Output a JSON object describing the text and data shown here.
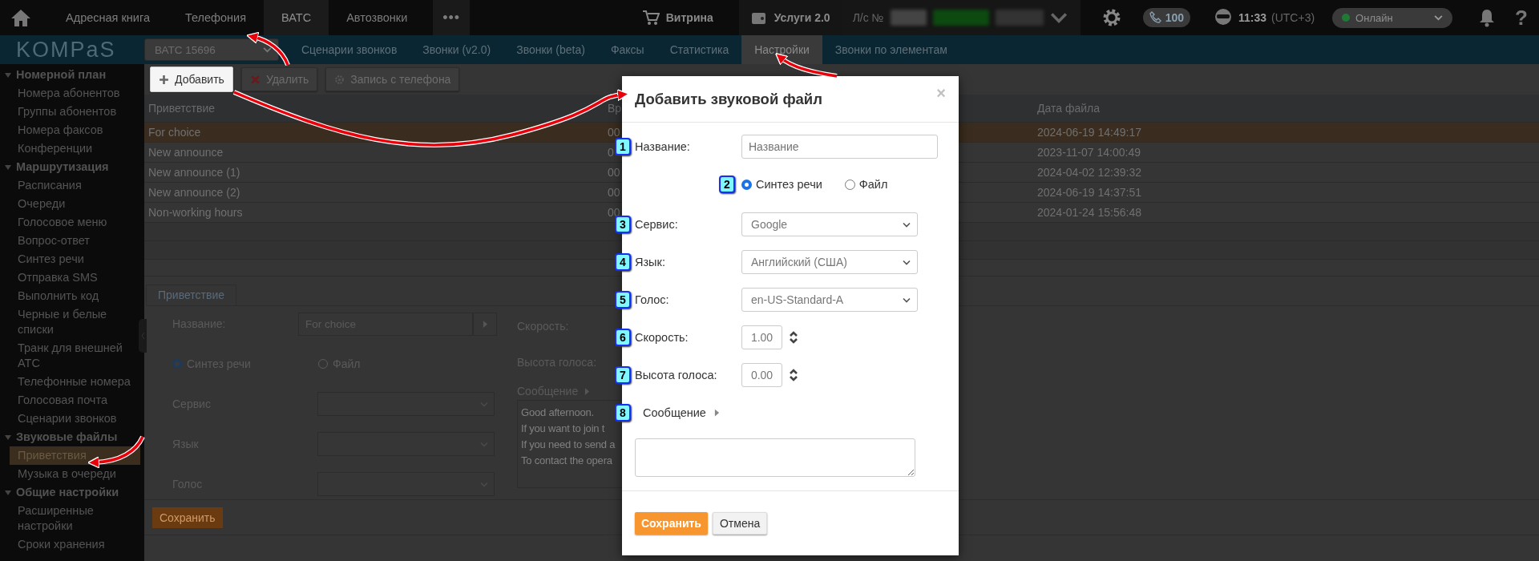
{
  "top_bar": {
    "tabs": [
      {
        "label": "Адресная книга",
        "selected": false
      },
      {
        "label": "Телефония",
        "selected": false
      },
      {
        "label": "ВАТС",
        "selected": true
      },
      {
        "label": "Автозвонки",
        "selected": false
      },
      {
        "label": "•••",
        "selected": false
      }
    ],
    "store": "Витрина",
    "services": "Услуги 2.0",
    "account_label": "Л/с №",
    "lines": "100",
    "time": "11:33",
    "timezone": "(UTC+3)",
    "status": {
      "label": "Онлайн",
      "color": "#1f7a35"
    },
    "help": "?"
  },
  "nav": {
    "logo": "KOMPaS",
    "pbx": "ВАТС 15696",
    "tabs": [
      {
        "label": "Сценарии звонков",
        "selected": false
      },
      {
        "label": "Звонки (v2.0)",
        "selected": false
      },
      {
        "label": "Звонки (beta)",
        "selected": false
      },
      {
        "label": "Факсы",
        "selected": false
      },
      {
        "label": "Статистика",
        "selected": false
      },
      {
        "label": "Настройки",
        "selected": true
      },
      {
        "label": "Звонки по элементам",
        "selected": false
      }
    ]
  },
  "sidebar": [
    {
      "label": "Номерной план",
      "expanded": true,
      "children": [
        {
          "label": "Номера абонентов",
          "selected": false
        },
        {
          "label": "Группы абонентов",
          "selected": false
        },
        {
          "label": "Номера факсов",
          "selected": false
        },
        {
          "label": "Конференции",
          "selected": false
        }
      ]
    },
    {
      "label": "Маршрутизация",
      "expanded": true,
      "children": [
        {
          "label": "Расписания",
          "selected": false
        },
        {
          "label": "Очереди",
          "selected": false
        },
        {
          "label": "Голосовое меню",
          "selected": false
        },
        {
          "label": "Вопрос-ответ",
          "selected": false
        },
        {
          "label": "Синтез речи",
          "selected": false
        },
        {
          "label": "Отправка SMS",
          "selected": false
        },
        {
          "label": "Выполнить код",
          "selected": false
        },
        {
          "label": "Черные и белые списки",
          "selected": false
        },
        {
          "label": "Транк для внешней АТС",
          "selected": false
        },
        {
          "label": "Телефонные номера",
          "selected": false
        },
        {
          "label": "Голосовая почта",
          "selected": false
        },
        {
          "label": "Сценарии звонков",
          "selected": false
        }
      ]
    },
    {
      "label": "Звуковые файлы",
      "expanded": true,
      "children": [
        {
          "label": "Приветствия",
          "selected": true
        },
        {
          "label": "Музыка в очереди",
          "selected": false
        }
      ]
    },
    {
      "label": "Общие настройки",
      "expanded": true,
      "children": [
        {
          "label": "Расширенные настройки",
          "selected": false
        },
        {
          "label": "Сроки хранения",
          "selected": false
        }
      ]
    }
  ],
  "toolbar": [
    {
      "label": "Добавить",
      "kind": "add",
      "highlighted": true
    },
    {
      "label": "Удалить",
      "kind": "delete",
      "highlighted": false
    },
    {
      "label": "Запись с телефона",
      "kind": "record",
      "highlighted": false
    }
  ],
  "table": {
    "columns": [
      "Приветствие",
      "Вр",
      "Дата файла"
    ],
    "rows": [
      {
        "cells": [
          "For choice",
          "00",
          "2024-06-19 14:49:17"
        ],
        "selected": true
      },
      {
        "cells": [
          "New announce",
          "0",
          "2023-11-07 14:00:49"
        ],
        "selected": false
      },
      {
        "cells": [
          "New announce (1)",
          "00",
          "2024-04-02 12:39:32"
        ],
        "selected": false
      },
      {
        "cells": [
          "New announce (2)",
          "00",
          "2024-06-19 14:37:51"
        ],
        "selected": false
      },
      {
        "cells": [
          "Non-working hours",
          "00",
          "2024-01-24 15:56:48"
        ],
        "selected": false
      }
    ]
  },
  "details": {
    "tab": {
      "label": "Приветствие",
      "selected": true
    },
    "name_label": "Название:",
    "name_value": "For choice",
    "source": [
      {
        "label": "Синтез речи",
        "selected": true
      },
      {
        "label": "Файл",
        "selected": false
      }
    ],
    "selects": [
      "Сервис",
      "Язык",
      "Голос"
    ],
    "speed_label": "Скорость:",
    "pitch_label": "Высота голоса:",
    "message_label": "Сообщение",
    "message_lines": [
      "Good afternoon.",
      "If you want to join t",
      "If you need to send a",
      "To contact the opera"
    ],
    "save": "Сохранить"
  },
  "dialog": {
    "title": "Добавить звуковой файл",
    "close": "×",
    "fields": [
      {
        "marker": "1",
        "kind": "text",
        "label": "Название:",
        "placeholder": "Название"
      },
      {
        "marker": "2",
        "kind": "radio",
        "options": [
          {
            "label": "Синтез речи",
            "selected": true
          },
          {
            "label": "Файл",
            "selected": false
          }
        ]
      },
      {
        "marker": "3",
        "kind": "select",
        "label": "Сервис:",
        "value": "Google"
      },
      {
        "marker": "4",
        "kind": "select",
        "label": "Язык:",
        "value": "Английский (США)"
      },
      {
        "marker": "5",
        "kind": "select",
        "label": "Голос:",
        "value": "en-US-Standard-A"
      },
      {
        "marker": "6",
        "kind": "number",
        "label": "Скорость:",
        "value": "1.00"
      },
      {
        "marker": "7",
        "kind": "number",
        "label": "Высота голоса:",
        "value": "0.00"
      },
      {
        "marker": "8",
        "kind": "textarea",
        "label": "Сообщение"
      }
    ],
    "buttons": [
      {
        "label": "Сохранить",
        "kind": "primary"
      },
      {
        "label": "Отмена",
        "kind": "secondary"
      }
    ]
  }
}
